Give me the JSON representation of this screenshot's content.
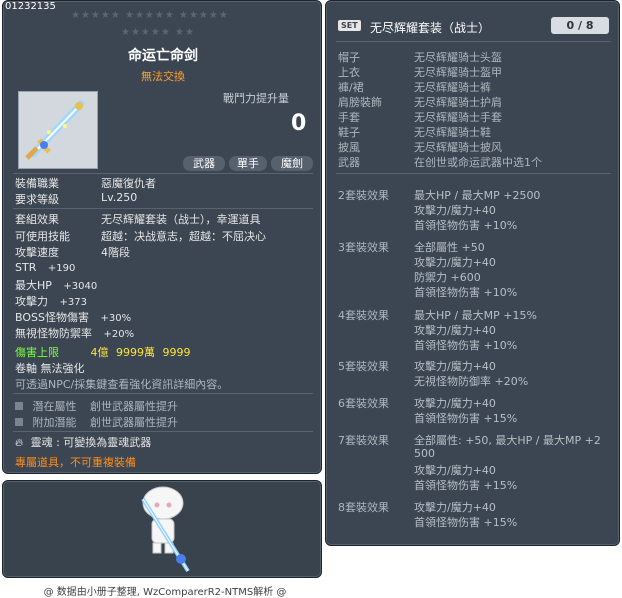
{
  "item": {
    "id": "01232135",
    "stars_row1": "★★★★★ ★★★★★ ★★★★★",
    "stars_row2": "★★★★★ ★★",
    "name": "命运亡命剑",
    "tradability": "無法交換",
    "power_label": "戰鬥力提升量",
    "power_value": "0",
    "tags": [
      "武器",
      "單手",
      "魔劍"
    ],
    "job_label": "裝備職業",
    "job_value": "惡魔復仇者",
    "level_label": "要求等級",
    "level_value": "Lv.250",
    "set_label": "套組效果",
    "set_value": "无尽辉耀套装（战士），幸運道具",
    "skill_label": "可使用技能",
    "skill_value": "超越：决战意志，超越：不屈决心",
    "speed_label": "攻擊速度",
    "speed_value": "4階段",
    "stats": [
      {
        "label": "STR",
        "value": "+190"
      },
      {
        "label": "最大HP",
        "value": "+3040"
      },
      {
        "label": "攻擊力",
        "value": "+373"
      },
      {
        "label": "BOSS怪物傷害",
        "value": "+30%"
      },
      {
        "label": "無視怪物防禦率",
        "value": "+20%"
      }
    ],
    "damage_cap_label": "傷害上限",
    "damage_cap_value1": "4億",
    "damage_cap_value2": "9999萬",
    "damage_cap_value3": "9999",
    "scroll_text": "卷軸 無法強化",
    "enhance_note": "可透過NPC/採集鍵查看強化資訊詳細內容。",
    "potential_label": "潛在屬性",
    "potential_value": "創世武器屬性提升",
    "additional_label": "附加潛能",
    "additional_value": "創世武器屬性提升",
    "soul_text": "靈魂 : 可變換為靈魂武器",
    "exclusive_text": "專屬道具，不可重複裝備"
  },
  "set_panel": {
    "badge": "SET",
    "title": "无尽辉耀套装（战士）",
    "count": "0 / 8",
    "pieces": [
      {
        "slot": "帽子",
        "name": "无尽辉耀骑士头盔"
      },
      {
        "slot": "上衣",
        "name": "无尽辉耀骑士盔甲"
      },
      {
        "slot": "褲/裙",
        "name": "无尽辉耀骑士裤"
      },
      {
        "slot": "肩膀裝飾",
        "name": "无尽辉耀骑士护肩"
      },
      {
        "slot": "手套",
        "name": "无尽辉耀骑士手套"
      },
      {
        "slot": "鞋子",
        "name": "无尽辉耀骑士鞋"
      },
      {
        "slot": "披風",
        "name": "无尽辉耀骑士披风"
      },
      {
        "slot": "武器",
        "name": "在创世或命运武器中选1个"
      }
    ],
    "effects": [
      {
        "label": "2套裝效果",
        "lines": [
          "最大HP / 最大MP  +2500",
          "攻擊力/魔力+40",
          "首領怪物伤害 +10%"
        ]
      },
      {
        "label": "3套裝效果",
        "lines": [
          "全部屬性 +50",
          "攻擊力/魔力+40",
          "防禦力 +600",
          "首領怪物伤害 +10%"
        ]
      },
      {
        "label": "4套裝效果",
        "lines": [
          "最大HP / 最大MP  +15%",
          "攻擊力/魔力+40",
          "首領怪物伤害 +10%"
        ]
      },
      {
        "label": "5套裝效果",
        "lines": [
          "攻擊力/魔力+40",
          "无視怪物防御率 +20%"
        ]
      },
      {
        "label": "6套裝效果",
        "lines": [
          "攻擊力/魔力+40",
          "首領怪物伤害 +15%"
        ]
      },
      {
        "label": "7套裝效果",
        "lines": [
          "全部屬性: +50, 最大HP / 最大MP  +2",
          "500",
          "攻擊力/魔力+40",
          "首領怪物伤害 +15%"
        ]
      },
      {
        "label": "8套裝效果",
        "lines": [
          "攻擊力/魔力+40",
          "首領怪物伤害 +15%"
        ]
      }
    ]
  },
  "footer": "@ 数据由小册子整理, WzComparerR2-NTMS解析 @",
  "colors": {
    "panel_bg": "#3b4652",
    "tradability": "#ff9d30",
    "damage_cap_label": "#7cff3c",
    "damage_cap_value": "#ffe23c",
    "exclusive": "#ff8c1a"
  }
}
